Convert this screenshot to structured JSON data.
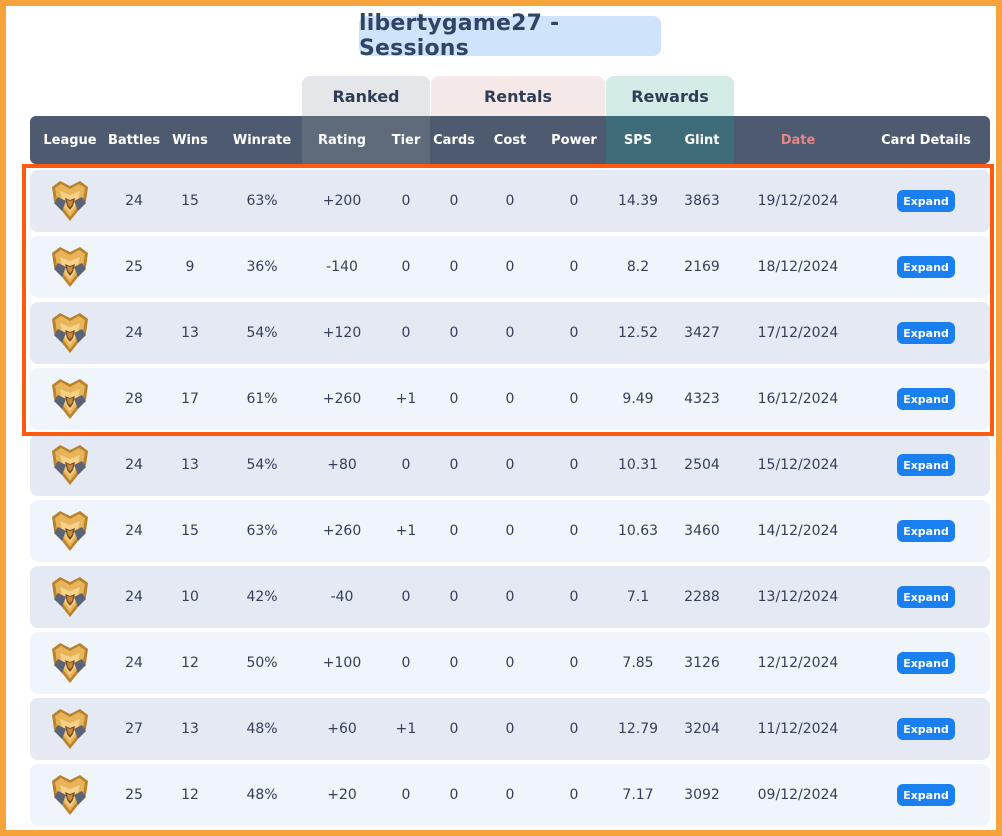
{
  "title": "libertygame27 - Sessions",
  "groups": {
    "ranked": "Ranked",
    "rentals": "Rentals",
    "rewards": "Rewards"
  },
  "columns": [
    "League",
    "Battles",
    "Wins",
    "Winrate",
    "Rating",
    "Tier",
    "Cards",
    "Cost",
    "Power",
    "SPS",
    "Glint",
    "Date",
    "Card Details"
  ],
  "expand_label": "Expand",
  "league_icon": "gold-league-shield-icon",
  "colors": {
    "frame": "#f5a33a",
    "header": "#4d5a70",
    "date_header": "#e58686",
    "highlight": "#ff5a10",
    "button": "#1a7ff0"
  },
  "rows": [
    {
      "battles": "24",
      "wins": "15",
      "winrate": "63%",
      "rating": "+200",
      "tier": "0",
      "cards": "0",
      "cost": "0",
      "power": "0",
      "sps": "14.39",
      "glint": "3863",
      "date": "19/12/2024"
    },
    {
      "battles": "25",
      "wins": "9",
      "winrate": "36%",
      "rating": "-140",
      "tier": "0",
      "cards": "0",
      "cost": "0",
      "power": "0",
      "sps": "8.2",
      "glint": "2169",
      "date": "18/12/2024"
    },
    {
      "battles": "24",
      "wins": "13",
      "winrate": "54%",
      "rating": "+120",
      "tier": "0",
      "cards": "0",
      "cost": "0",
      "power": "0",
      "sps": "12.52",
      "glint": "3427",
      "date": "17/12/2024"
    },
    {
      "battles": "28",
      "wins": "17",
      "winrate": "61%",
      "rating": "+260",
      "tier": "+1",
      "cards": "0",
      "cost": "0",
      "power": "0",
      "sps": "9.49",
      "glint": "4323",
      "date": "16/12/2024"
    },
    {
      "battles": "24",
      "wins": "13",
      "winrate": "54%",
      "rating": "+80",
      "tier": "0",
      "cards": "0",
      "cost": "0",
      "power": "0",
      "sps": "10.31",
      "glint": "2504",
      "date": "15/12/2024"
    },
    {
      "battles": "24",
      "wins": "15",
      "winrate": "63%",
      "rating": "+260",
      "tier": "+1",
      "cards": "0",
      "cost": "0",
      "power": "0",
      "sps": "10.63",
      "glint": "3460",
      "date": "14/12/2024"
    },
    {
      "battles": "24",
      "wins": "10",
      "winrate": "42%",
      "rating": "-40",
      "tier": "0",
      "cards": "0",
      "cost": "0",
      "power": "0",
      "sps": "7.1",
      "glint": "2288",
      "date": "13/12/2024"
    },
    {
      "battles": "24",
      "wins": "12",
      "winrate": "50%",
      "rating": "+100",
      "tier": "0",
      "cards": "0",
      "cost": "0",
      "power": "0",
      "sps": "7.85",
      "glint": "3126",
      "date": "12/12/2024"
    },
    {
      "battles": "27",
      "wins": "13",
      "winrate": "48%",
      "rating": "+60",
      "tier": "+1",
      "cards": "0",
      "cost": "0",
      "power": "0",
      "sps": "12.79",
      "glint": "3204",
      "date": "11/12/2024"
    },
    {
      "battles": "25",
      "wins": "12",
      "winrate": "48%",
      "rating": "+20",
      "tier": "0",
      "cards": "0",
      "cost": "0",
      "power": "0",
      "sps": "7.17",
      "glint": "3092",
      "date": "09/12/2024"
    }
  ]
}
